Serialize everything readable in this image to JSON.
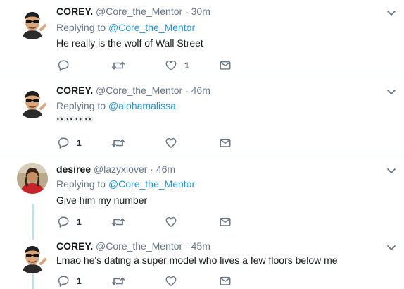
{
  "tweets": [
    {
      "name": "COREY.",
      "handle": "@Core_the_Mentor",
      "separator": "·",
      "time": "30m",
      "replying_prefix": "Replying to ",
      "replying_to": "@Core_the_Mentor",
      "text": "He really is the wolf of Wall Street",
      "reply_count": "",
      "like_count": "1"
    },
    {
      "name": "COREY.",
      "handle": "@Core_the_Mentor",
      "separator": "·",
      "time": "46m",
      "replying_prefix": "Replying to ",
      "replying_to": "@alohamalissa",
      "text": "👀👀👀👀",
      "reply_count": "1",
      "like_count": ""
    },
    {
      "name": "desiree",
      "handle": "@lazyxlover",
      "separator": "·",
      "time": "46m",
      "replying_prefix": "Replying to ",
      "replying_to": "@Core_the_Mentor",
      "text": "Give him my number",
      "reply_count": "1",
      "like_count": ""
    },
    {
      "name": "COREY.",
      "handle": "@Core_the_Mentor",
      "separator": "·",
      "time": "45m",
      "text": "Lmao he's dating a super model who lives a few floors below me",
      "reply_count": "1",
      "like_count": ""
    }
  ],
  "icons": {
    "reply": "reply-icon",
    "retweet": "retweet-icon",
    "like": "heart-icon",
    "dm": "envelope-icon",
    "menu": "chevron-down-icon"
  },
  "colors": {
    "link": "#1b95e0",
    "muted": "#657786",
    "thread_line": "#c4e0e3",
    "divider": "#e6ecf0"
  }
}
